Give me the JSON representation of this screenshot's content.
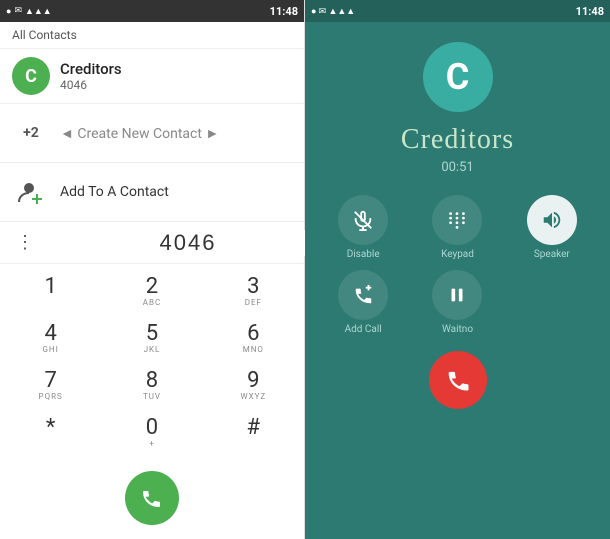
{
  "left": {
    "statusBar": {
      "time": "11:48",
      "icons": "● ✉ ▲ ▲ ▲"
    },
    "allContacts": "All Contacts",
    "contact": {
      "initial": "C",
      "name": "Creditors",
      "number": "4046"
    },
    "createContact": {
      "plusTwo": "+2",
      "label": "Create New Contact",
      "arrows": "◄ ►"
    },
    "addContact": {
      "label": "Add To A Contact"
    },
    "dialInput": {
      "value": "4046"
    },
    "dialpad": [
      {
        "main": "1",
        "sub": ""
      },
      {
        "main": "2",
        "sub": "ABC"
      },
      {
        "main": "3",
        "sub": "DEF"
      },
      {
        "main": "4",
        "sub": "GHI"
      },
      {
        "main": "5",
        "sub": "JKL"
      },
      {
        "main": "6",
        "sub": "MNO"
      },
      {
        "main": "7",
        "sub": "PQRS"
      },
      {
        "main": "8",
        "sub": "TUV"
      },
      {
        "main": "9",
        "sub": "WXYZ"
      },
      {
        "main": "*",
        "sub": ""
      },
      {
        "main": "0",
        "sub": "+"
      },
      {
        "main": "#",
        "sub": ""
      }
    ],
    "callBtn": "📞"
  },
  "right": {
    "statusBar": {
      "time": "11:48"
    },
    "initial": "C",
    "callerName": "Creditors",
    "duration": "00:51",
    "actions": [
      {
        "icon": "🎤",
        "label": "Disable",
        "active": false
      },
      {
        "icon": "⌨",
        "label": "Keypad",
        "active": false
      },
      {
        "icon": "🔊",
        "label": "Speaker",
        "active": true
      }
    ],
    "actions2": [
      {
        "icon": "T",
        "label": "Add Call",
        "active": false
      },
      {
        "icon": "⏸",
        "label": "Waitno",
        "active": false
      }
    ],
    "endCall": "📞"
  }
}
